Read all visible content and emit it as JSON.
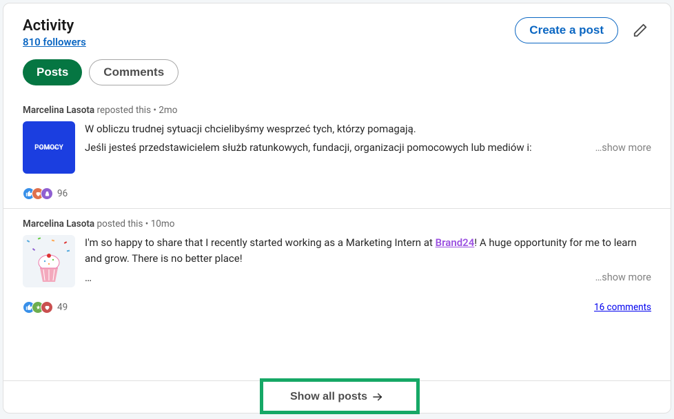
{
  "header": {
    "title": "Activity",
    "followers": "810 followers",
    "create_post": "Create a post"
  },
  "tabs": {
    "posts": "Posts",
    "comments": "Comments"
  },
  "posts": [
    {
      "author": "Marcelina Lasota",
      "action": "reposted this",
      "time": "2mo",
      "thumb_label": "POMOCY",
      "line1": "W obliczu trudnej sytuacji chcielibyśmy wesprzeć tych, którzy pomagają.",
      "line2": "Jeśli jesteś przedstawicielem służb ratunkowych, fundacji, organizacji pomocowych lub mediów i:",
      "show_more": "…show more",
      "reactions_count": "96"
    },
    {
      "author": "Marcelina Lasota",
      "action": "posted this",
      "time": "10mo",
      "line1_prefix": "I'm so happy to share that I recently started working as a Marketing Intern at ",
      "brand": "Brand24",
      "line1_suffix": "! A huge opportunity for me to learn and grow. There is no better place!",
      "ellipsis": "…",
      "show_more": "…show more",
      "reactions_count": "49",
      "comments_count": "16 comments"
    }
  ],
  "footer": {
    "show_all": "Show all posts"
  }
}
